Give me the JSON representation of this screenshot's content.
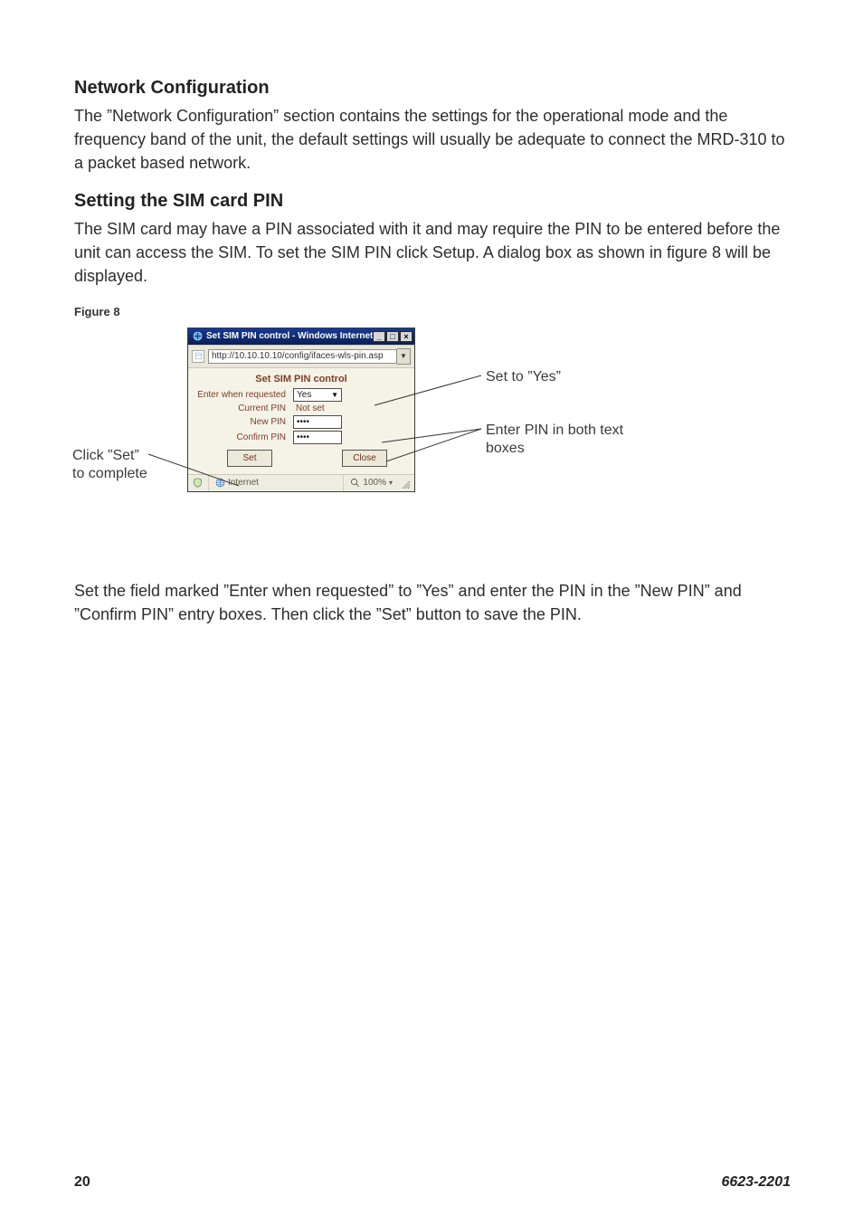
{
  "sections": {
    "netconf": {
      "heading": "Network Configuration",
      "body": "The ”Network Configuration” section contains the settings for the operational mode and the frequency band of the unit, the default settings will usually be adequate to connect the MRD-310 to a packet based network."
    },
    "simpin": {
      "heading": "Setting the SIM card PIN",
      "body": "The SIM card may have a PIN associated with it and may require the PIN to be entered before the unit can access the SIM. To set the SIM PIN click Setup. A dialog box as shown in figure 8 will be displayed.",
      "figcaption": "Figure 8",
      "after": "Set the field marked ”Enter when requested” to ”Yes” and enter the PIN in the ”New PIN” and ”Confirm PIN” entry boxes. Then click the ”Set” button to save the PIN."
    }
  },
  "dialog": {
    "title": "Set SIM PIN control - Windows Internet...",
    "url": "http://10.10.10.10/config/ifaces-wls-pin.asp",
    "heading": "Set SIM PIN control",
    "rows": {
      "enter_when_requested": {
        "label": "Enter when requested",
        "value": "Yes"
      },
      "current_pin": {
        "label": "Current PIN",
        "value": "Not set"
      },
      "new_pin": {
        "label": "New PIN",
        "value": "••••"
      },
      "confirm_pin": {
        "label": "Confirm PIN",
        "value": "••••"
      }
    },
    "buttons": {
      "set": "Set",
      "close": "Close"
    },
    "status": {
      "zone": "Internet",
      "zoom": "100%"
    }
  },
  "annotations": {
    "set_to_yes": "Set to ”Yes”",
    "enter_pin_both": "Enter PIN in both text boxes",
    "click_set_1": "Click ”Set”",
    "click_set_2": "to complete"
  },
  "footer": {
    "page": "20",
    "docnum": "6623-2201"
  }
}
